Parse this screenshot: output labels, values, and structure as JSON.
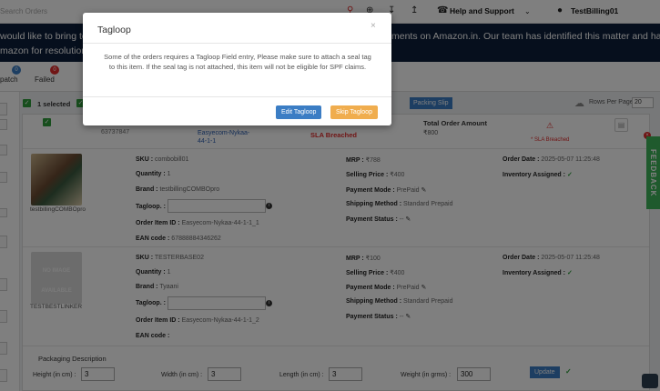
{
  "topbar": {
    "search_placeholder": "Search Orders",
    "help_label": "Help and Support",
    "user_name": "TestBilling01"
  },
  "banner": {
    "line1": "would like to bring to",
    "line1_right": "ments on Amazon.in. Our team has identified this matter and ha",
    "line2": "mazon for resolution"
  },
  "status": {
    "batch_count": "0",
    "batch_label": "patch",
    "failed_count": "0",
    "failed_label": "Failed"
  },
  "actions": {
    "selected_text": "1 selected",
    "packing_slip": "Packing Slip",
    "rows_per_page_label": "Rows Per Page",
    "rows_per_page_value": "20"
  },
  "summary": {
    "order_id": "63737847",
    "channel_order": "Easyecom-Nykaa-44-1-1",
    "sla": "SLA Breached",
    "total_label": "Total Order Amount",
    "total_value": "₹800",
    "sla_small": "* SLA Breached"
  },
  "items": [
    {
      "product_name": "testbillingCOMBOpro",
      "sku_label": "SKU :",
      "sku": "combobill01",
      "qty_label": "Quantity :",
      "qty": "1",
      "brand_label": "Brand :",
      "brand": "testbillingCOMBOpro",
      "tagloop_label": "Tagloop. :",
      "order_item_label": "Order Item ID :",
      "order_item": "Easyecom-Nykaa-44-1-1_1",
      "ean_label": "EAN code :",
      "ean": "67888884346262",
      "mrp_label": "MRP :",
      "mrp": "₹788",
      "sp_label": "Selling Price :",
      "sp": "₹400",
      "pm_label": "Payment Mode :",
      "pm": "PrePaid",
      "sm_label": "Shipping Method :",
      "sm": "Standard Prepaid",
      "ps_label": "Payment Status :",
      "ps": "--",
      "od_label": "Order Date :",
      "od": "2025-05-07 11:25:48",
      "ia_label": "Inventory Assigned :"
    },
    {
      "product_name": "TESTBESTLINKER",
      "img_text_top": "NO IMAGE",
      "img_text_bottom": "AVAILABLE",
      "sku_label": "SKU :",
      "sku": "TESTERBASE02",
      "qty_label": "Quantity :",
      "qty": "1",
      "brand_label": "Brand :",
      "brand": "Tyaani",
      "tagloop_label": "Tagloop. :",
      "order_item_label": "Order Item ID :",
      "order_item": "Easyecom-Nykaa-44-1-1_2",
      "ean_label": "EAN code :",
      "ean": "",
      "mrp_label": "MRP :",
      "mrp": "₹100",
      "sp_label": "Selling Price :",
      "sp": "₹400",
      "pm_label": "Payment Mode :",
      "pm": "PrePaid",
      "sm_label": "Shipping Method :",
      "sm": "Standard Prepaid",
      "ps_label": "Payment Status :",
      "ps": "--",
      "od_label": "Order Date :",
      "od": "2025-05-07 11:25:48",
      "ia_label": "Inventory Assigned :"
    }
  ],
  "packaging": {
    "title": "Packaging Description",
    "height_label": "Height (in cm) :",
    "height": "3",
    "width_label": "Width (in cm) :",
    "width": "3",
    "length_label": "Length (in cm) :",
    "length": "3",
    "weight_label": "Weight (in grms) :",
    "weight": "300",
    "update_label": "Update"
  },
  "feedback_label": "FEEDBACK",
  "modal": {
    "title": "Tagloop",
    "close": "×",
    "body": "Some of the orders requires a Tagloop Field entry, Please make sure to attach a seal tag to this item. If the seal tag is not attached, this item will not be eligible for SPF claims.",
    "primary": "Edit Tagloop",
    "secondary": "Skip Tagloop"
  },
  "colors": {
    "banner": "#0d1e3a",
    "primary": "#3b7dc4",
    "secondary": "#f0ad4e",
    "green": "#2e9d3a",
    "red": "#e02b2b"
  }
}
